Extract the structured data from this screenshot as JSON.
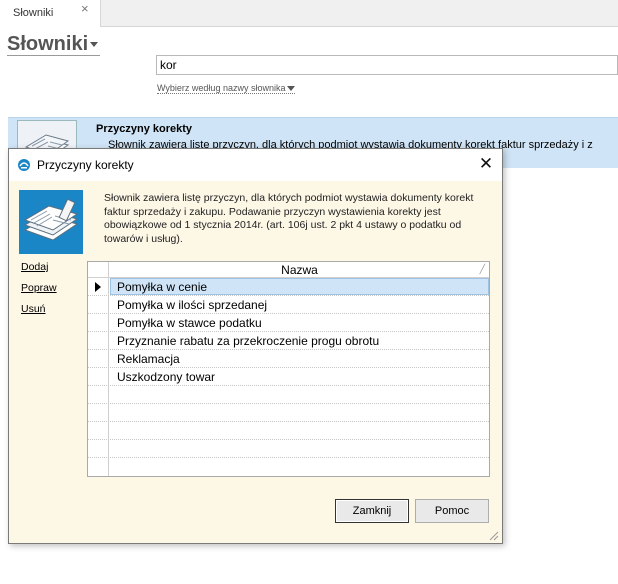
{
  "tab": {
    "label": "Słowniki",
    "close_label": "×"
  },
  "page": {
    "title": "Słowniki",
    "search": {
      "value": "kor",
      "placeholder": ""
    },
    "filter_label": "Wybierz według nazwy słownika"
  },
  "result": {
    "title": "Przyczyny korekty",
    "description": "Słownik zawiera listę przyczyn, dla których podmiot wystawia dokumenty korekt faktur sprzedaży i z"
  },
  "dialog": {
    "title": "Przyczyny korekty",
    "close_label": "✕",
    "description": "Słownik zawiera listę przyczyn, dla których podmiot wystawia dokumenty korekt faktur sprzedaży i zakupu. Podawanie przyczyn wystawienia korekty jest obowiązkowe od 1 stycznia 2014r. (art. 106j ust. 2 pkt 4 ustawy o podatku od towarów i usług).",
    "links": {
      "add": "Dodaj",
      "edit": "Popraw",
      "delete": "Usuń"
    },
    "grid": {
      "column_header": "Nazwa",
      "rows": [
        "Pomyłka w cenie",
        "Pomyłka w ilości sprzedanej",
        "Pomyłka w stawce podatku",
        "Przyznanie rabatu za przekroczenie progu obrotu",
        "Reklamacja",
        "Uszkodzony towar"
      ],
      "selected_index": 0
    },
    "buttons": {
      "close": "Zamknij",
      "help": "Pomoc"
    }
  },
  "colors": {
    "selection": "#cfe4f6",
    "dialog_bg": "#fdf7e6",
    "accent_blue": "#1a86c6"
  }
}
